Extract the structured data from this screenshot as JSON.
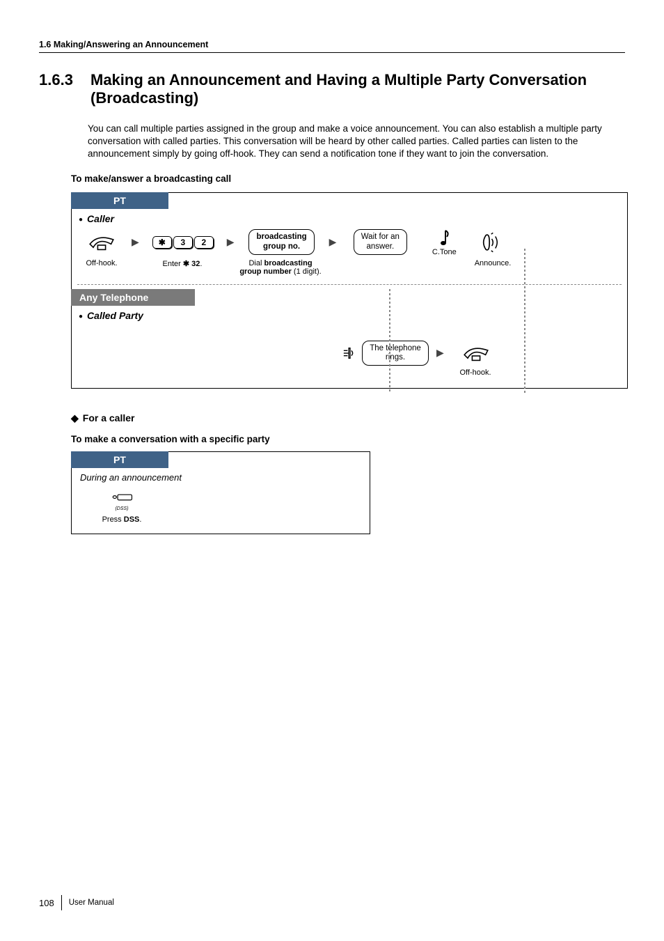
{
  "header": {
    "breadcrumb": "1.6 Making/Answering an Announcement"
  },
  "title": {
    "number": "1.6.3",
    "text": "Making an Announcement and Having a Multiple Party Conversation (Broadcasting)"
  },
  "intro": "You can call multiple parties assigned in the group and make a voice announcement. You can also establish a multiple party conversation with called parties. This conversation will be heard by other called parties. Called parties can listen to the announcement simply by going off-hook. They can send a notification tone if they want to join the conversation.",
  "sub1": "To make/answer a broadcasting call",
  "diag1": {
    "tab_pt": "PT",
    "caller_label": "Caller",
    "tab_any": "Any Telephone",
    "called_label": "Called Party",
    "keys": {
      "star": "✱",
      "k3": "3",
      "k2": "2"
    },
    "box_bcast": "broadcasting\ngroup no.",
    "box_wait": "Wait for an\nanswer.",
    "ctone": "C.Tone",
    "announce": "Announce.",
    "cap_offhook": "Off-hook.",
    "cap_enter": "Enter    32.",
    "cap_enter_star": "✱",
    "cap_dial1": "Dial ",
    "cap_dial_bold": "broadcasting",
    "cap_dial2_bold": "group number",
    "cap_dial2_rest": " (1 digit).",
    "box_rings": "The telephone\nrings.",
    "cap_offhook2": "Off-hook."
  },
  "sec2_head": "For a caller",
  "sub2": "To make a conversation with a specific party",
  "diag2": {
    "tab_pt": "PT",
    "during": "During an announcement",
    "dss_label": "(DSS)",
    "press": "Press ",
    "press_bold": "DSS",
    "press_end": "."
  },
  "footer": {
    "page": "108",
    "label": "User Manual"
  }
}
